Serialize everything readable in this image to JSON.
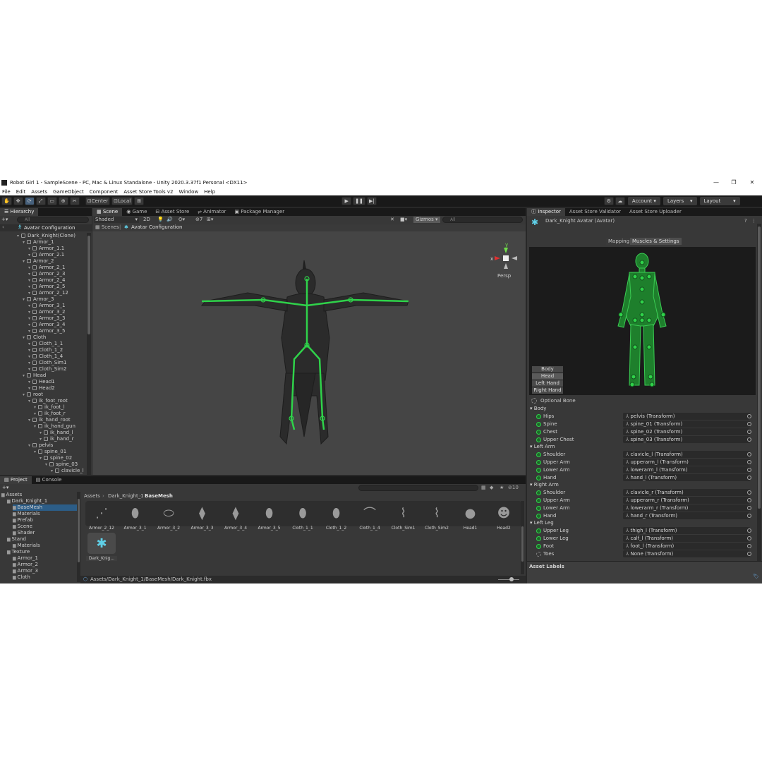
{
  "window": {
    "title": "Robot Girl 1 - SampleScene - PC, Mac & Linux Standalone - Unity 2020.3.37f1 Personal <DX11>",
    "minimize": "—",
    "maximize": "❐",
    "close": "✕"
  },
  "menu": [
    "File",
    "Edit",
    "Assets",
    "GameObject",
    "Component",
    "Asset Store Tools v2",
    "Window",
    "Help"
  ],
  "toolbar": {
    "pivot": "Center",
    "space": "Local",
    "account": "Account",
    "layers": "Layers",
    "layout": "Layout"
  },
  "hierarchy": {
    "tab": "Hierarchy",
    "search_placeholder": "All",
    "scene_header": "Avatar Configuration",
    "items": [
      {
        "label": "Dark_Knight(Clone)",
        "depth": 0
      },
      {
        "label": "Armor_1",
        "depth": 1
      },
      {
        "label": "Armor_1.1",
        "depth": 2
      },
      {
        "label": "Armor_2.1",
        "depth": 2
      },
      {
        "label": "Armor_2",
        "depth": 1
      },
      {
        "label": "Armor_2_1",
        "depth": 2
      },
      {
        "label": "Armor_2_3",
        "depth": 2
      },
      {
        "label": "Armor_2_4",
        "depth": 2
      },
      {
        "label": "Armor_2_5",
        "depth": 2
      },
      {
        "label": "Armor_2_12",
        "depth": 2
      },
      {
        "label": "Armor_3",
        "depth": 1
      },
      {
        "label": "Armor_3_1",
        "depth": 2
      },
      {
        "label": "Armor_3_2",
        "depth": 2
      },
      {
        "label": "Armor_3_3",
        "depth": 2
      },
      {
        "label": "Armor_3_4",
        "depth": 2
      },
      {
        "label": "Armor_3_5",
        "depth": 2
      },
      {
        "label": "Cloth",
        "depth": 1
      },
      {
        "label": "Cloth_1_1",
        "depth": 2
      },
      {
        "label": "Cloth_1_2",
        "depth": 2
      },
      {
        "label": "Cloth_1_4",
        "depth": 2
      },
      {
        "label": "Cloth_Sim1",
        "depth": 2
      },
      {
        "label": "Cloth_Sim2",
        "depth": 2
      },
      {
        "label": "Head",
        "depth": 1
      },
      {
        "label": "Head1",
        "depth": 2
      },
      {
        "label": "Head2",
        "depth": 2
      },
      {
        "label": "root",
        "depth": 1
      },
      {
        "label": "ik_foot_root",
        "depth": 2
      },
      {
        "label": "ik_foot_l",
        "depth": 3
      },
      {
        "label": "ik_foot_r",
        "depth": 3
      },
      {
        "label": "ik_hand_root",
        "depth": 2
      },
      {
        "label": "ik_hand_gun",
        "depth": 3
      },
      {
        "label": "ik_hand_l",
        "depth": 4
      },
      {
        "label": "ik_hand_r",
        "depth": 4
      },
      {
        "label": "pelvis",
        "depth": 2
      },
      {
        "label": "spine_01",
        "depth": 3
      },
      {
        "label": "spine_02",
        "depth": 4
      },
      {
        "label": "spine_03",
        "depth": 5
      },
      {
        "label": "clavicle_l",
        "depth": 6
      }
    ]
  },
  "scene": {
    "tabs": [
      "Scene",
      "Game",
      "Asset Store",
      "Animator",
      "Package Manager"
    ],
    "shading": "Shaded",
    "mode_2d": "2D",
    "gizmos": "Gizmos",
    "search_placeholder": "All",
    "fx_count": "7",
    "breadcrumb": [
      "Scenes",
      "Avatar Configuration"
    ],
    "persp": "Persp",
    "axis_y": "y",
    "axis_x": "x"
  },
  "project": {
    "tabs": [
      "Project",
      "Console"
    ],
    "tree": [
      {
        "label": "Assets",
        "depth": 0
      },
      {
        "label": "Dark_Knight_1",
        "depth": 1
      },
      {
        "label": "BaseMesh",
        "depth": 2
      },
      {
        "label": "Materials",
        "depth": 2
      },
      {
        "label": "Prefab",
        "depth": 2
      },
      {
        "label": "Scene",
        "depth": 2
      },
      {
        "label": "Shader",
        "depth": 2
      },
      {
        "label": "Stand",
        "depth": 1
      },
      {
        "label": "Materials",
        "depth": 2
      },
      {
        "label": "Texture",
        "depth": 1
      },
      {
        "label": "Armor_1",
        "depth": 2
      },
      {
        "label": "Armor_2",
        "depth": 2
      },
      {
        "label": "Armor_3",
        "depth": 2
      },
      {
        "label": "Cloth",
        "depth": 2
      }
    ],
    "breadcrumb": [
      "Assets",
      "Dark_Knight_1",
      "BaseMesh"
    ],
    "assets": [
      "Armor_2_12",
      "Armor_3_1",
      "Armor_3_2",
      "Armor_3_3",
      "Armor_3_4",
      "Armor_3_5",
      "Cloth_1_1",
      "Cloth_1_2",
      "Cloth_1_4",
      "Cloth_Sim1",
      "Cloth_Sim2",
      "Head1",
      "Head2"
    ],
    "selected_asset": "Dark_Knig...",
    "hidden_count": "10",
    "path": "Assets/Dark_Knight_1/BaseMesh/Dark_Knight.fbx"
  },
  "inspector": {
    "tabs": [
      "Inspector",
      "Asset Store Validator",
      "Asset Store Uploader"
    ],
    "title": "Dark_Knight Avatar (Avatar)",
    "subtabs": [
      "Mapping",
      "Muscles & Settings"
    ],
    "body_buttons": [
      "Body",
      "Head",
      "Left Hand",
      "Right Hand"
    ],
    "optional_bone": "Optional Bone",
    "sections": [
      {
        "name": "Body",
        "bones": [
          [
            "Hips",
            "pelvis (Transform)"
          ],
          [
            "Spine",
            "spine_01 (Transform)"
          ],
          [
            "Chest",
            "spine_02 (Transform)"
          ],
          [
            "Upper Chest",
            "spine_03 (Transform)"
          ]
        ]
      },
      {
        "name": "Left Arm",
        "bones": [
          [
            "Shoulder",
            "clavicle_l (Transform)"
          ],
          [
            "Upper Arm",
            "upperarm_l (Transform)"
          ],
          [
            "Lower Arm",
            "lowerarm_l (Transform)"
          ],
          [
            "Hand",
            "hand_l (Transform)"
          ]
        ]
      },
      {
        "name": "Right Arm",
        "bones": [
          [
            "Shoulder",
            "clavicle_r (Transform)"
          ],
          [
            "Upper Arm",
            "upperarm_r (Transform)"
          ],
          [
            "Lower Arm",
            "lowerarm_r (Transform)"
          ],
          [
            "Hand",
            "hand_r (Transform)"
          ]
        ]
      },
      {
        "name": "Left Leg",
        "bones": [
          [
            "Upper Leg",
            "thigh_l (Transform)"
          ],
          [
            "Lower Leg",
            "calf_l (Transform)"
          ],
          [
            "Foot",
            "foot_l (Transform)"
          ],
          [
            "Toes",
            "None (Transform)"
          ]
        ]
      }
    ],
    "asset_labels": "Asset Labels"
  },
  "colors": {
    "bone_green": "#2fd24a",
    "editor_bg": "#383838",
    "selection": "#2c5d87"
  }
}
